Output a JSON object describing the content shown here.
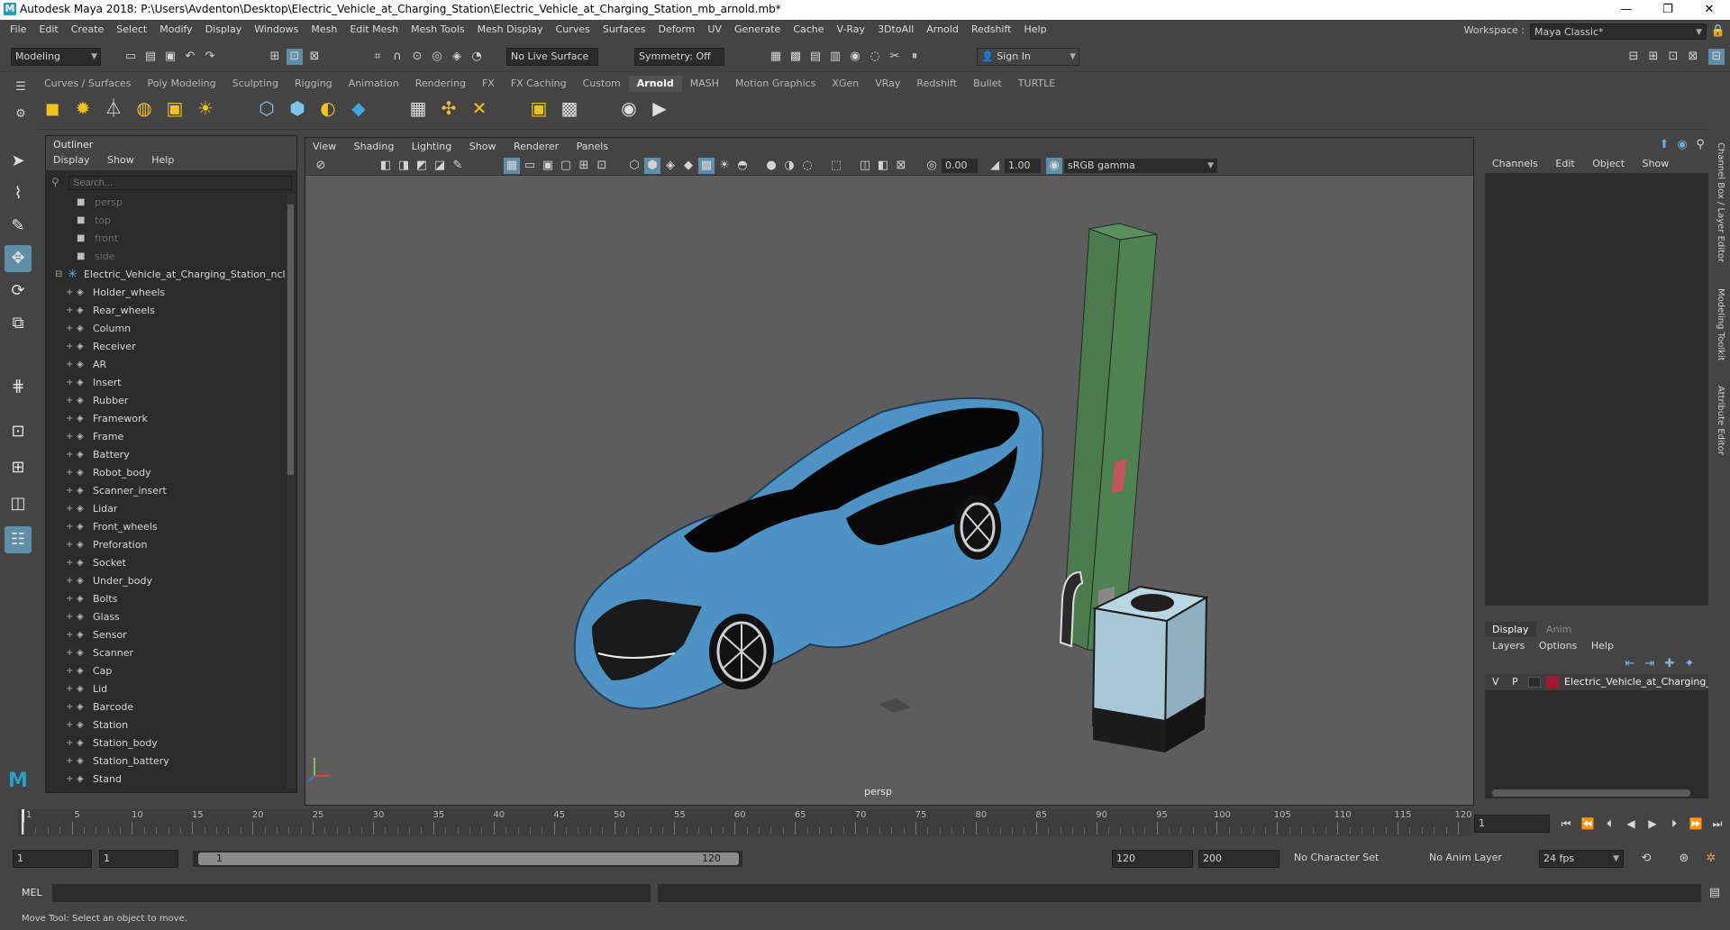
{
  "window": {
    "title": "Autodesk Maya 2018: P:\\Users\\Avdenton\\Desktop\\Electric_Vehicle_at_Charging_Station\\Electric_Vehicle_at_Charging_Station_mb_arnold.mb*",
    "app_icon": "M",
    "minimize": "—",
    "maximize": "❐",
    "close": "✕"
  },
  "menu": [
    "File",
    "Edit",
    "Create",
    "Select",
    "Modify",
    "Display",
    "Windows",
    "Mesh",
    "Edit Mesh",
    "Mesh Tools",
    "Mesh Display",
    "Curves",
    "Surfaces",
    "Deform",
    "UV",
    "Generate",
    "Cache",
    "V-Ray",
    "3DtoAll",
    "Arnold",
    "Redshift",
    "Help"
  ],
  "workspace": {
    "label": "Workspace :",
    "value": "Maya Classic*"
  },
  "status_line": {
    "mode": "Modeling",
    "live_surface": "No Live Surface",
    "symmetry": "Symmetry: Off",
    "sign_in": "Sign In"
  },
  "shelf_tabs": [
    "Curves / Surfaces",
    "Poly Modeling",
    "Sculpting",
    "Rigging",
    "Animation",
    "Rendering",
    "FX",
    "FX Caching",
    "Custom",
    "Arnold",
    "MASH",
    "Motion Graphics",
    "XGen",
    "VRay",
    "Redshift",
    "Bullet",
    "TURTLE"
  ],
  "shelf_active": "Arnold",
  "outliner": {
    "title": "Outliner",
    "menus": [
      "Display",
      "Show",
      "Help"
    ],
    "search_placeholder": "Search...",
    "cameras": [
      "persp",
      "top",
      "front",
      "side"
    ],
    "group": "Electric_Vehicle_at_Charging_Station_ncl",
    "children": [
      "Holder_wheels",
      "Rear_wheels",
      "Column",
      "Receiver",
      "AR",
      "Insert",
      "Rubber",
      "Framework",
      "Frame",
      "Battery",
      "Robot_body",
      "Scanner_insert",
      "Lidar",
      "Front_wheels",
      "Preforation",
      "Socket",
      "Under_body",
      "Bolts",
      "Glass",
      "Sensor",
      "Scanner",
      "Cap",
      "Lid",
      "Barcode",
      "Station",
      "Station_body",
      "Station_battery",
      "Stand"
    ]
  },
  "viewport": {
    "menus": [
      "View",
      "Shading",
      "Lighting",
      "Show",
      "Renderer",
      "Panels"
    ],
    "exposure": "0.00",
    "gamma": "1.00",
    "color_space": "sRGB gamma",
    "camera_label": "persp",
    "colors": {
      "car_body": "#4d94c4",
      "column": "#4b7a4e",
      "station": "#a9c8d6"
    }
  },
  "channel_box": {
    "menus": [
      "Channels",
      "Edit",
      "Object",
      "Show"
    ],
    "vertical_tabs": [
      "Channel Box / Layer Editor",
      "Modeling Toolkit",
      "Attribute Editor"
    ]
  },
  "layer_editor": {
    "tabs": [
      "Display",
      "Anim"
    ],
    "active_tab": "Display",
    "menus": [
      "Layers",
      "Options",
      "Help"
    ],
    "layer": {
      "v": "V",
      "p": "P",
      "name": "Electric_Vehicle_at_Charging_S",
      "color": "#9c1b2e"
    }
  },
  "timeline": {
    "ticks": [
      "1",
      "5",
      "10",
      "15",
      "20",
      "25",
      "30",
      "35",
      "40",
      "45",
      "50",
      "55",
      "60",
      "65",
      "70",
      "75",
      "80",
      "85",
      "90",
      "95",
      "100",
      "105",
      "110",
      "115",
      "120"
    ],
    "current_frame": "1"
  },
  "range": {
    "start": "1",
    "playback_start": "1",
    "slider_start": "1",
    "slider_end": "120",
    "playback_end": "120",
    "end": "200",
    "character_set": "No Character Set",
    "anim_layer": "No Anim Layer",
    "fps": "24 fps"
  },
  "command_line": {
    "label": "MEL"
  },
  "help_line": {
    "text": "Move Tool: Select an object to move."
  }
}
